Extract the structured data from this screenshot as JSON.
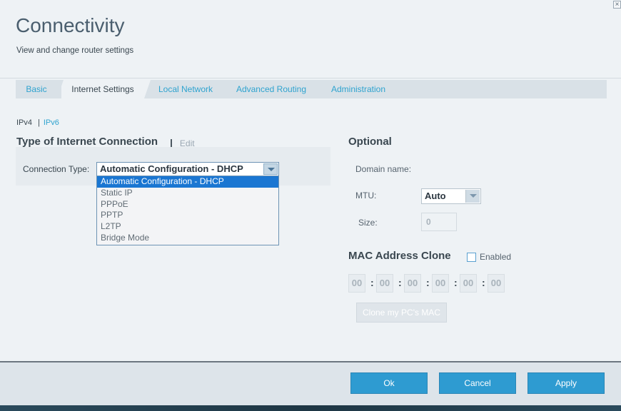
{
  "header": {
    "title": "Connectivity",
    "subtitle": "View and change router settings",
    "close_icon": "close-icon"
  },
  "tabs": [
    {
      "label": "Basic",
      "active": false
    },
    {
      "label": "Internet Settings",
      "active": true
    },
    {
      "label": "Local Network",
      "active": false
    },
    {
      "label": "Advanced Routing",
      "active": false
    },
    {
      "label": "Administration",
      "active": false
    }
  ],
  "subnav": {
    "ipv4": "IPv4",
    "separator": "|",
    "ipv6": "IPv6"
  },
  "connection": {
    "section_title": "Type of Internet Connection",
    "separator": "|",
    "edit_label": "Edit",
    "type_label": "Connection Type:",
    "selected": "Automatic Configuration - DHCP",
    "options": [
      "Automatic Configuration - DHCP",
      "Static IP",
      "PPPoE",
      "PPTP",
      "L2TP",
      "Bridge Mode"
    ]
  },
  "optional": {
    "section_title": "Optional",
    "domain_label": "Domain name:",
    "mtu_label": "MTU:",
    "mtu_value": "Auto",
    "size_label": "Size:",
    "size_value": "0"
  },
  "mac_clone": {
    "section_title": "MAC Address Clone",
    "enabled_label": "Enabled",
    "enabled": false,
    "octets": [
      "00",
      "00",
      "00",
      "00",
      "00",
      "00"
    ],
    "separator": ":",
    "clone_button": "Clone my PC's MAC"
  },
  "footer": {
    "ok": "Ok",
    "cancel": "Cancel",
    "apply": "Apply"
  },
  "colors": {
    "accent": "#2e9bd1",
    "link": "#2fa3cf",
    "selected_option": "#1a76d2"
  }
}
